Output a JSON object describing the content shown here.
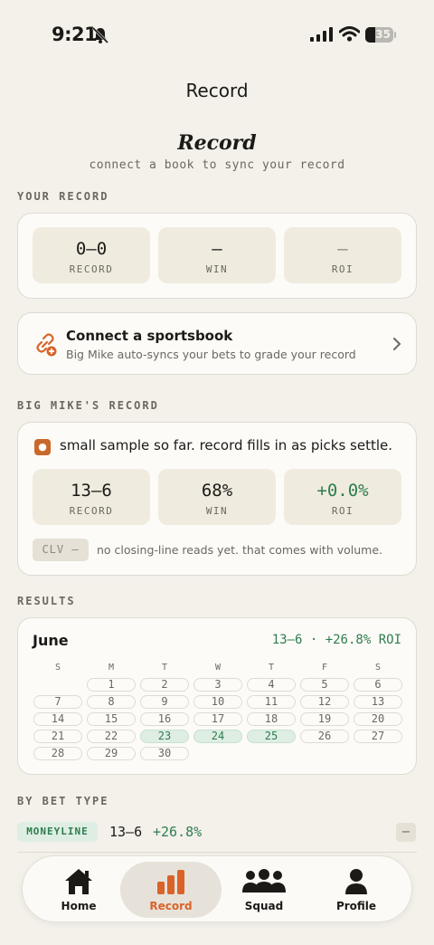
{
  "status_bar": {
    "time": "9:21",
    "battery": "35",
    "battery_level": 0.35
  },
  "nav": {
    "title": "Record"
  },
  "header": {
    "title": "Record",
    "subtitle": "connect a book to sync your record"
  },
  "your_record": {
    "section_label": "YOUR RECORD",
    "stats": [
      {
        "value": "0–0",
        "label": "RECORD"
      },
      {
        "value": "—",
        "label": "WIN"
      },
      {
        "value": "—",
        "label": "ROI"
      }
    ]
  },
  "connect": {
    "title": "Connect a sportsbook",
    "subtitle": "Big Mike auto-syncs your bets to grade your record",
    "icon": "link-plus-icon"
  },
  "mike_record": {
    "section_label": "BIG MIKE'S RECORD",
    "message": "small sample so far. record fills in as picks settle.",
    "stats": [
      {
        "value": "13–6",
        "label": "RECORD"
      },
      {
        "value": "68%",
        "label": "WIN"
      },
      {
        "value": "+0.0%",
        "label": "ROI"
      }
    ],
    "clv_label": "CLV —",
    "clv_text": "no closing-line reads yet. that comes with volume."
  },
  "results": {
    "section_label": "RESULTS",
    "month": "June",
    "summary": "13–6 · +26.8% ROI",
    "weekdays": [
      "S",
      "M",
      "T",
      "W",
      "T",
      "F",
      "S"
    ],
    "weeks": [
      [
        "",
        "1",
        "2",
        "3",
        "4",
        "5",
        "6"
      ],
      [
        "7",
        "8",
        "9",
        "10",
        "11",
        "12",
        "13"
      ],
      [
        "14",
        "15",
        "16",
        "17",
        "18",
        "19",
        "20"
      ],
      [
        "21",
        "22",
        "23",
        "24",
        "25",
        "26",
        "27"
      ],
      [
        "28",
        "29",
        "30",
        "",
        "",
        "",
        ""
      ]
    ],
    "win_days": [
      "23",
      "24",
      "25"
    ]
  },
  "bet_type": {
    "section_label": "BY BET TYPE",
    "rows": [
      {
        "tag": "MONEYLINE",
        "record": "13–6",
        "roi": "+26.8%",
        "action": "−"
      }
    ]
  },
  "tabs": [
    {
      "label": "Home",
      "icon": "home-icon",
      "active": false
    },
    {
      "label": "Record",
      "icon": "bar-chart-icon",
      "active": true
    },
    {
      "label": "Squad",
      "icon": "group-icon",
      "active": false
    },
    {
      "label": "Profile",
      "icon": "person-icon",
      "active": false
    }
  ],
  "colors": {
    "accent": "#d9632a",
    "positive": "#2e7d4f",
    "background": "#f3f1ea"
  }
}
